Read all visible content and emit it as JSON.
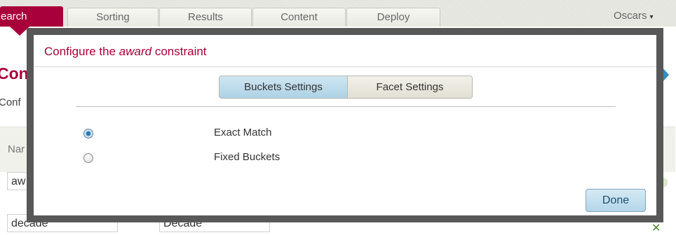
{
  "nav": {
    "tabs": [
      {
        "label": "earch",
        "active": true
      },
      {
        "label": "Sorting",
        "active": false
      },
      {
        "label": "Results",
        "active": false
      },
      {
        "label": "Content",
        "active": false
      },
      {
        "label": "Deploy",
        "active": false
      }
    ],
    "user_menu": "Oscars",
    "user_menu_caret": "▾"
  },
  "background": {
    "heading": "Con",
    "subtitle": "Conf",
    "column_header": "Nar",
    "row1_input": "aw",
    "row2_input_a": "decade",
    "row2_input_b": "Decade",
    "right_arrow_icon": "chevron-right-icon",
    "remove_icon": "✕"
  },
  "modal": {
    "title_prefix": "Configure the ",
    "title_em": "award",
    "title_suffix": " constraint",
    "tabs": {
      "buckets": "Buckets Settings",
      "facet": "Facet Settings"
    },
    "options": [
      {
        "label": "Exact Match",
        "checked": true
      },
      {
        "label": "Fixed Buckets",
        "checked": false
      }
    ],
    "done_label": "Done"
  },
  "colors": {
    "brand": "#a8003a",
    "modal_border": "#585858",
    "button_blue": "#b3d6e9"
  }
}
